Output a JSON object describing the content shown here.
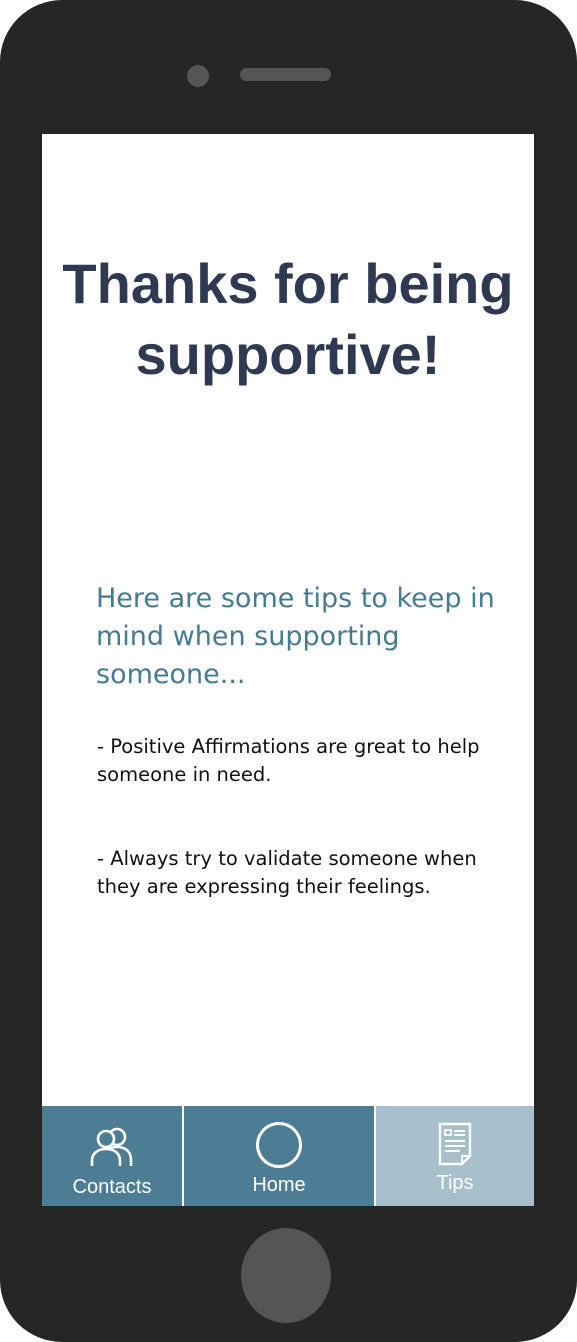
{
  "header": {
    "title": "Thanks for being supportive!"
  },
  "main": {
    "intro": "Here are some tips to keep in mind when supporting someone...",
    "tips": [
      "- Positive Affirmations are great to help someone in need.",
      "- Always try to validate someone when they are expressing their feelings."
    ]
  },
  "tabbar": {
    "tabs": [
      {
        "label": "Contacts",
        "icon": "contacts-icon",
        "active": false
      },
      {
        "label": "Home",
        "icon": "circle-icon",
        "active": false
      },
      {
        "label": "Tips",
        "icon": "document-icon",
        "active": true
      }
    ]
  },
  "colors": {
    "phone_frame": "#262626",
    "title": "#2f3a52",
    "subtitle": "#457a92",
    "tab_default": "#4d7d94",
    "tab_active": "#a7bfcb"
  }
}
